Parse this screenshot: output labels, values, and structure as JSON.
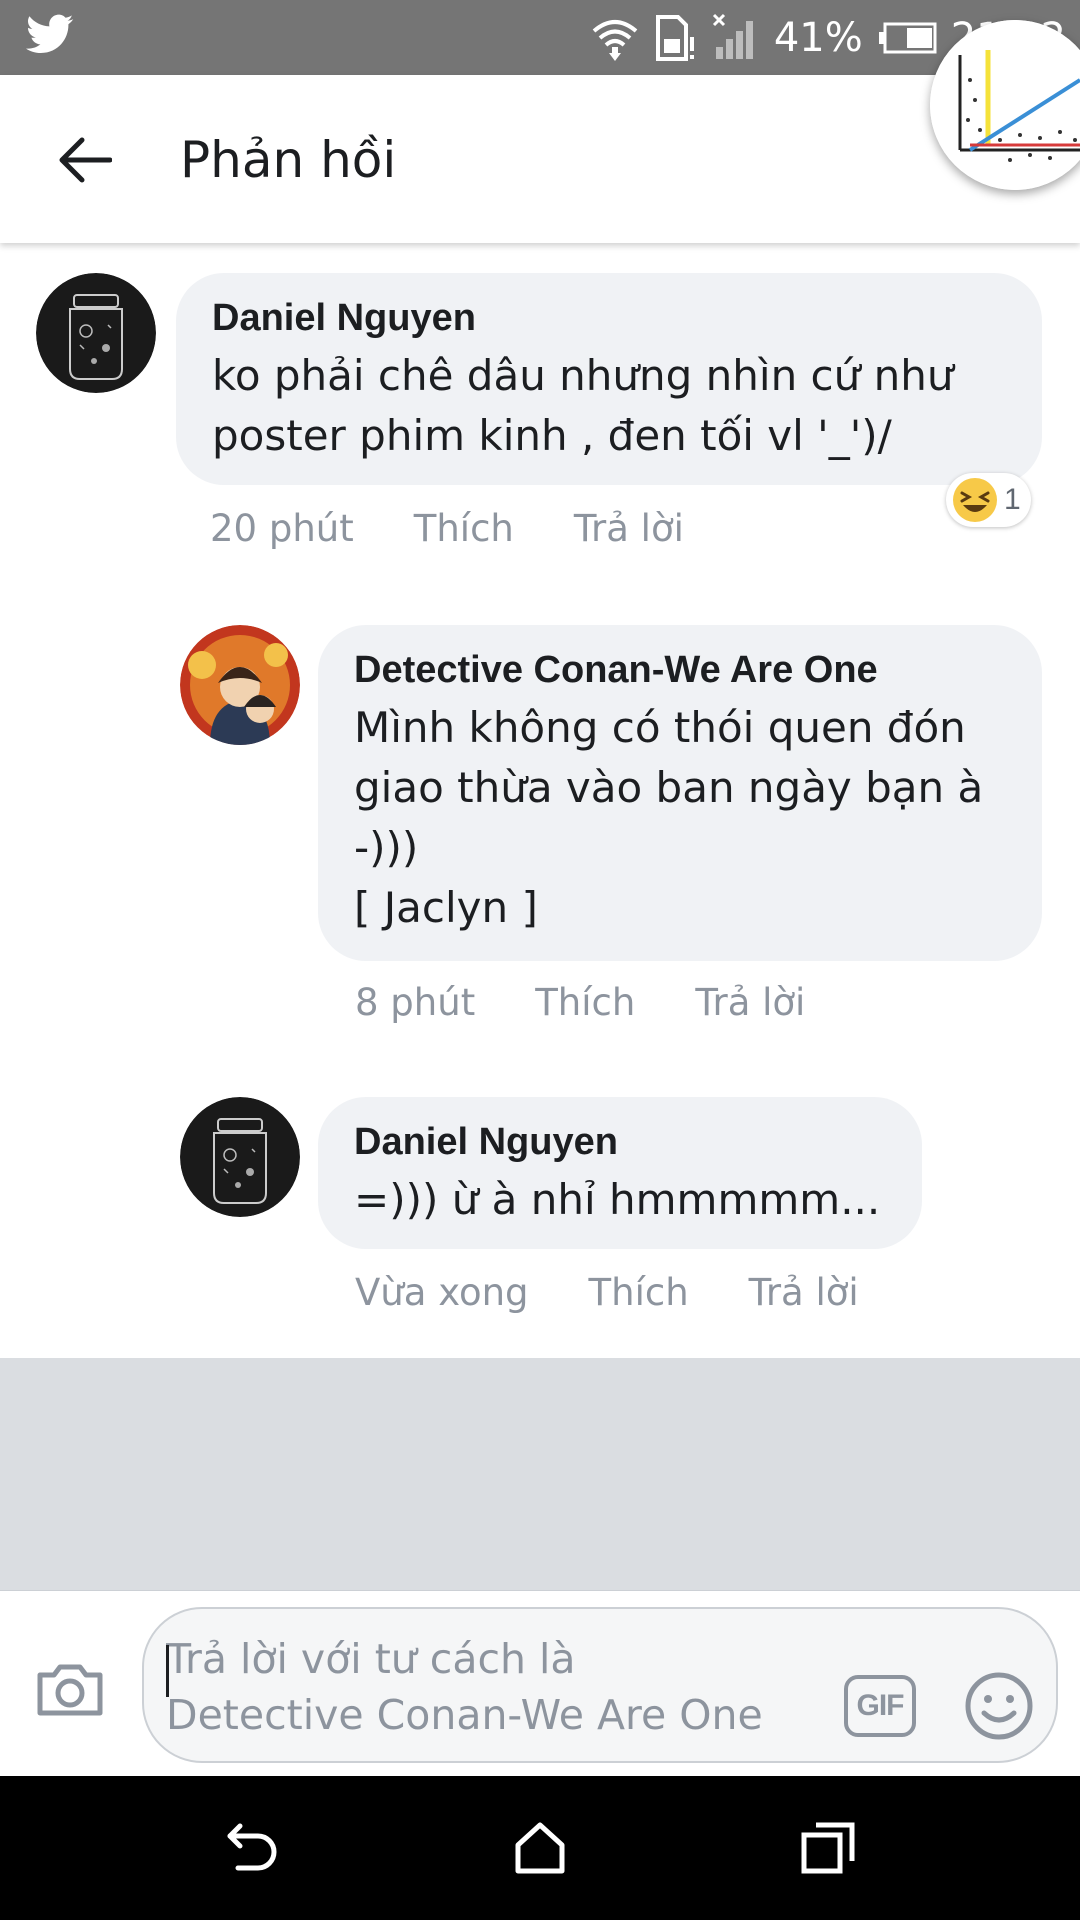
{
  "status_bar": {
    "app_icon": "twitter-icon",
    "battery_percent": "41%",
    "time": "21:12",
    "icons": [
      "wifi-icon",
      "sim-icon",
      "signal-icon",
      "battery-icon"
    ]
  },
  "header": {
    "title": "Phản hồi",
    "back_icon": "back-arrow-icon",
    "chat_head_icon": "chat-head-avatar"
  },
  "comments": [
    {
      "author": "Daniel Nguyen",
      "text": "ko phải chê dâu nhưng nhìn cứ như\nposter phim kinh , đen tối vl '_')/",
      "time": "20 phút",
      "like_label": "Thích",
      "reply_label": "Trả lời",
      "reaction": {
        "icon": "laughing-emoji-icon",
        "count": "1"
      }
    },
    {
      "author": "Detective Conan-We Are One",
      "text": "Mình không có thói quen đón\ngiao thừa vào ban ngày bạn à\n-)))\n[ Jaclyn ]",
      "time": "8 phút",
      "like_label": "Thích",
      "reply_label": "Trả lời"
    },
    {
      "author": "Daniel Nguyen",
      "text": "=))) ừ à nhỉ hmmmmm...",
      "time": "Vừa xong",
      "like_label": "Thích",
      "reply_label": "Trả lời"
    }
  ],
  "composer": {
    "placeholder": "Trả lời với tư cách là\nDetective Conan-We Are One",
    "gif_label": "GIF",
    "camera_icon": "camera-icon",
    "emoji_icon": "smiley-icon"
  },
  "nav_bar": {
    "icons": [
      "back-nav-icon",
      "home-nav-icon",
      "recents-nav-icon"
    ]
  },
  "colors": {
    "status_bar": "#757575",
    "bubble": "#f0f2f5",
    "meta_text": "#8d949e",
    "separator_area": "#dadde1"
  }
}
